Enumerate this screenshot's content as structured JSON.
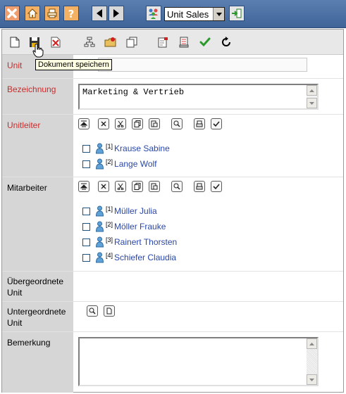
{
  "top_toolbar": {
    "buttons": [
      {
        "name": "close",
        "icon": "close-icon"
      },
      {
        "name": "home",
        "icon": "home-icon"
      },
      {
        "name": "print",
        "icon": "printer-icon"
      },
      {
        "name": "help",
        "icon": "help-icon"
      },
      {
        "name": "back",
        "icon": "arrow-left-icon"
      },
      {
        "name": "forward",
        "icon": "arrow-right-icon"
      },
      {
        "name": "users",
        "icon": "users-icon"
      },
      {
        "name": "go",
        "icon": "enter-icon"
      }
    ],
    "unit_select": {
      "selected": "Unit Sales"
    }
  },
  "doc_toolbar": {
    "tooltip": "Dokument speichern"
  },
  "fields": {
    "unit": {
      "label": "Unit",
      "value": ""
    },
    "bezeichnung": {
      "label": "Bezeichnung",
      "value": "Marketing & Vertrieb"
    },
    "unitleiter": {
      "label": "Unitleiter",
      "people": [
        {
          "index": "[1]",
          "name": "Krause Sabine"
        },
        {
          "index": "[2]",
          "name": "Lange Wolf"
        }
      ]
    },
    "mitarbeiter": {
      "label": "Mitarbeiter",
      "people": [
        {
          "index": "[1]",
          "name": "Müller Julia"
        },
        {
          "index": "[2]",
          "name": "Möller Frauke"
        },
        {
          "index": "[3]",
          "name": "Rainert Thorsten"
        },
        {
          "index": "[4]",
          "name": "Schiefer Claudia"
        }
      ]
    },
    "uebergeordnete": {
      "label_line1": "Übergeordnete",
      "label_line2": "Unit"
    },
    "untergeordnete": {
      "label_line1": "Untergeordnete",
      "label_line2": "Unit"
    },
    "bemerkung": {
      "label": "Bemerkung",
      "value": ""
    }
  },
  "colors": {
    "required_label": "#cc2b2b",
    "link": "#2a47a7",
    "toolbar": "#4a6fa3"
  }
}
